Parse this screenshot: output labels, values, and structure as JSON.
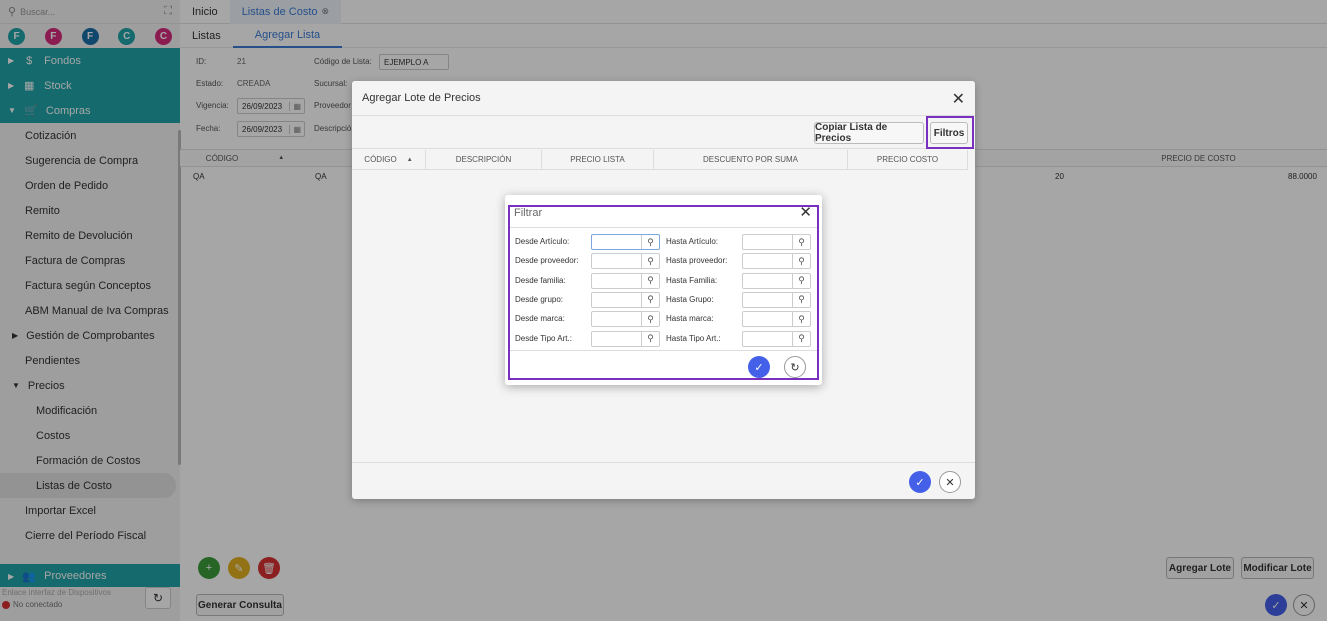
{
  "sidebar": {
    "search_placeholder": "Buscar...",
    "favorites": [
      {
        "letter": "F",
        "color": "#1fa3a8"
      },
      {
        "letter": "F",
        "color": "#d62c7e"
      },
      {
        "letter": "F",
        "color": "#1a6fa8"
      },
      {
        "letter": "C",
        "color": "#1fa3a8"
      },
      {
        "letter": "C",
        "color": "#d62c7e"
      }
    ],
    "top_items": [
      {
        "label": "Fondos",
        "icon": "$"
      },
      {
        "label": "Stock",
        "icon": "▦"
      },
      {
        "label": "Compras",
        "icon": "🛒"
      }
    ],
    "compras_items": [
      "Cotización",
      "Sugerencia de Compra",
      "Orden de Pedido",
      "Remito",
      "Remito de Devolución",
      "Factura de Compras",
      "Factura según Conceptos",
      "ABM Manual de Iva Compras"
    ],
    "gestion_label": "Gestión de Comprobantes",
    "pendientes_label": "Pendientes",
    "precios_label": "Precios",
    "precios_items": [
      "Modificación",
      "Costos",
      "Formación de Costos",
      "Listas de Costo"
    ],
    "tail_items": [
      "Importar Excel",
      "Cierre del Período Fiscal"
    ],
    "proveedores_label": "Proveedores",
    "device_interface": "Enlace interfaz de Dispositivos",
    "connection_status": "No conectado"
  },
  "tabs": {
    "inicio": "Inicio",
    "listas_costo": "Listas de Costo"
  },
  "subtabs": {
    "listas": "Listas",
    "agregar": "Agregar Lista"
  },
  "form": {
    "id_label": "ID:",
    "id_value": "21",
    "estado_label": "Estado:",
    "estado_value": "CREADA",
    "vigencia_label": "Vigencia:",
    "vigencia_value": "26/09/2023",
    "fecha_label": "Fecha:",
    "fecha_value": "26/09/2023",
    "codigo_lista_label": "Código de Lista:",
    "codigo_lista_value": "EJEMPLO A",
    "sucursal_label": "Sucursal:",
    "proveedor_label": "Proveedor",
    "descripcion_label": "Descripció"
  },
  "grid": {
    "col_codigo": "CÓDIGO",
    "col_precio_costo": "PRECIO DE COSTO",
    "row_codigo": "QA",
    "row_desc": "QA",
    "row_qty": "20",
    "row_price": "88.0000"
  },
  "footer": {
    "generar": "Generar Consulta",
    "agregar_lote": "Agregar Lote",
    "modificar_lote": "Modificar Lote"
  },
  "lote_modal": {
    "title": "Agregar Lote de Precios",
    "copy_button": "Copiar Lista de Precios",
    "filtros_button": "Filtros",
    "columns": [
      "CÓDIGO",
      "DESCRIPCIÓN",
      "PRECIO LISTA",
      "DESCUENTO POR SUMA",
      "PRECIO COSTO"
    ]
  },
  "filter_modal": {
    "title": "Filtrar",
    "rows": [
      {
        "from": "Desde Artículo:",
        "to": "Hasta Artículo:"
      },
      {
        "from": "Desde proveedor:",
        "to": "Hasta proveedor:"
      },
      {
        "from": "Desde familia:",
        "to": "Hasta Familia:"
      },
      {
        "from": "Desde grupo:",
        "to": "Hasta Grupo:"
      },
      {
        "from": "Desde marca:",
        "to": "Hasta marca:"
      },
      {
        "from": "Desde Tipo Art.:",
        "to": "Hasta Tipo Art.:"
      }
    ]
  },
  "colors": {
    "teal": "#1fa3a8",
    "accent_blue": "#3a7bd5",
    "confirm_blue": "#4460e8",
    "highlight": "#7b2fbe"
  }
}
